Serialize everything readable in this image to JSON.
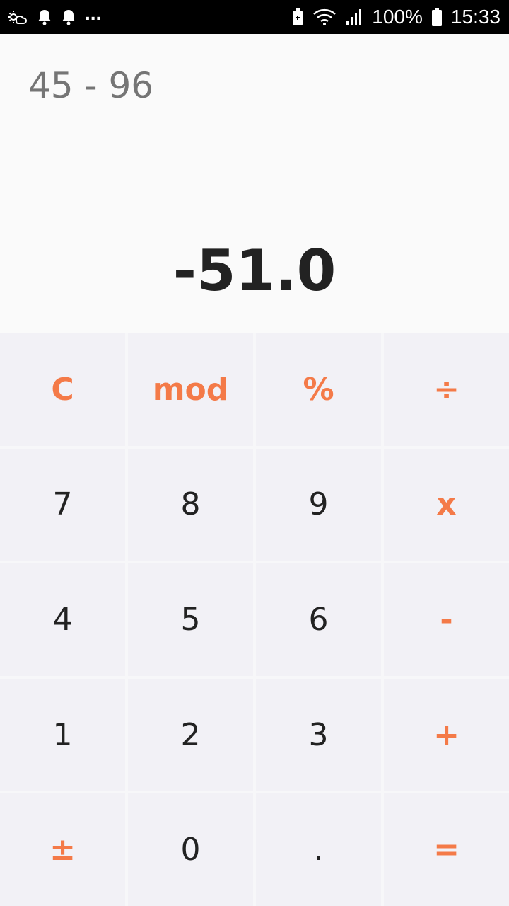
{
  "status_bar": {
    "battery_percent": "100%",
    "time": "15:33",
    "more": "...",
    "icons": [
      "weather-icon",
      "notification-bell-icon",
      "notification-bell-icon",
      "battery-saver-icon",
      "wifi-icon",
      "signal-icon",
      "battery-icon"
    ]
  },
  "display": {
    "expression": "45 - 96",
    "result": "-51.0"
  },
  "keypad": {
    "keys": [
      {
        "label": "C",
        "type": "op",
        "name": "clear-button"
      },
      {
        "label": "mod",
        "type": "op",
        "name": "mod-button"
      },
      {
        "label": "%",
        "type": "op",
        "name": "percent-button"
      },
      {
        "label": "÷",
        "type": "op",
        "name": "divide-button"
      },
      {
        "label": "7",
        "type": "num",
        "name": "digit-7-button"
      },
      {
        "label": "8",
        "type": "num",
        "name": "digit-8-button"
      },
      {
        "label": "9",
        "type": "num",
        "name": "digit-9-button"
      },
      {
        "label": "x",
        "type": "op",
        "name": "multiply-button"
      },
      {
        "label": "4",
        "type": "num",
        "name": "digit-4-button"
      },
      {
        "label": "5",
        "type": "num",
        "name": "digit-5-button"
      },
      {
        "label": "6",
        "type": "num",
        "name": "digit-6-button"
      },
      {
        "label": "-",
        "type": "op",
        "name": "subtract-button"
      },
      {
        "label": "1",
        "type": "num",
        "name": "digit-1-button"
      },
      {
        "label": "2",
        "type": "num",
        "name": "digit-2-button"
      },
      {
        "label": "3",
        "type": "num",
        "name": "digit-3-button"
      },
      {
        "label": "+",
        "type": "op",
        "name": "add-button"
      },
      {
        "label": "±",
        "type": "op",
        "name": "plus-minus-button"
      },
      {
        "label": "0",
        "type": "num",
        "name": "digit-0-button"
      },
      {
        "label": ".",
        "type": "num",
        "name": "decimal-point-button"
      },
      {
        "label": "=",
        "type": "op",
        "name": "equals-button"
      }
    ]
  },
  "colors": {
    "accent": "#f47a48",
    "digit": "#222222",
    "key_background": "#f2f1f6",
    "expression": "#757575"
  }
}
